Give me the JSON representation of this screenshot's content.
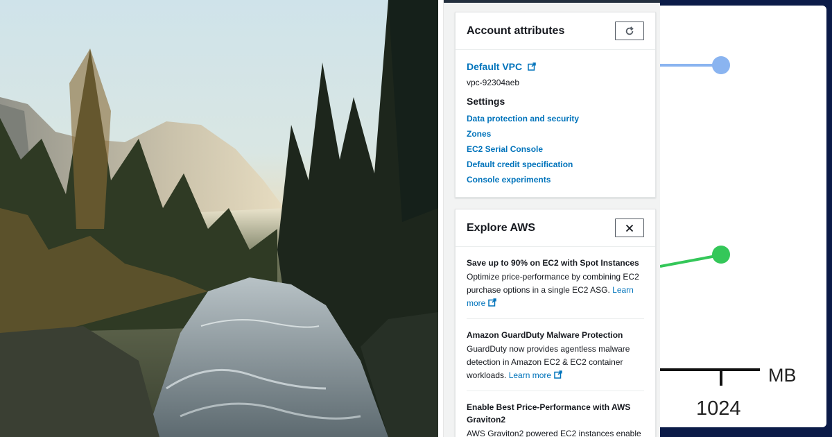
{
  "account_attributes": {
    "title": "Account attributes",
    "default_vpc_label": "Default VPC",
    "vpc_id": "vpc-92304aeb",
    "settings_heading": "Settings",
    "settings_links": [
      "Data protection and security",
      "Zones",
      "EC2 Serial Console",
      "Default credit specification",
      "Console experiments"
    ]
  },
  "explore_aws": {
    "title": "Explore AWS",
    "items": [
      {
        "title": "Save up to 90% on EC2 with Spot Instances",
        "desc": "Optimize price-performance by combining EC2 purchase options in a single EC2 ASG.",
        "link": "Learn more"
      },
      {
        "title": "Amazon GuardDuty Malware Protection",
        "desc": "GuardDuty now provides agentless malware detection in Amazon EC2 & EC2 container workloads.",
        "link": "Learn more"
      },
      {
        "title": "Enable Best Price-Performance with AWS Graviton2",
        "desc": "AWS Graviton2 powered EC2 instances enable",
        "link": ""
      }
    ]
  },
  "diagram": {
    "unit_label": "MB",
    "tick_label": "1024",
    "colors": {
      "blue_node": "#8ab4f0",
      "green_node": "#34c759",
      "axis": "#111111"
    }
  },
  "icons": {
    "refresh": "refresh-icon",
    "close": "close-icon",
    "external": "external-link-icon"
  }
}
